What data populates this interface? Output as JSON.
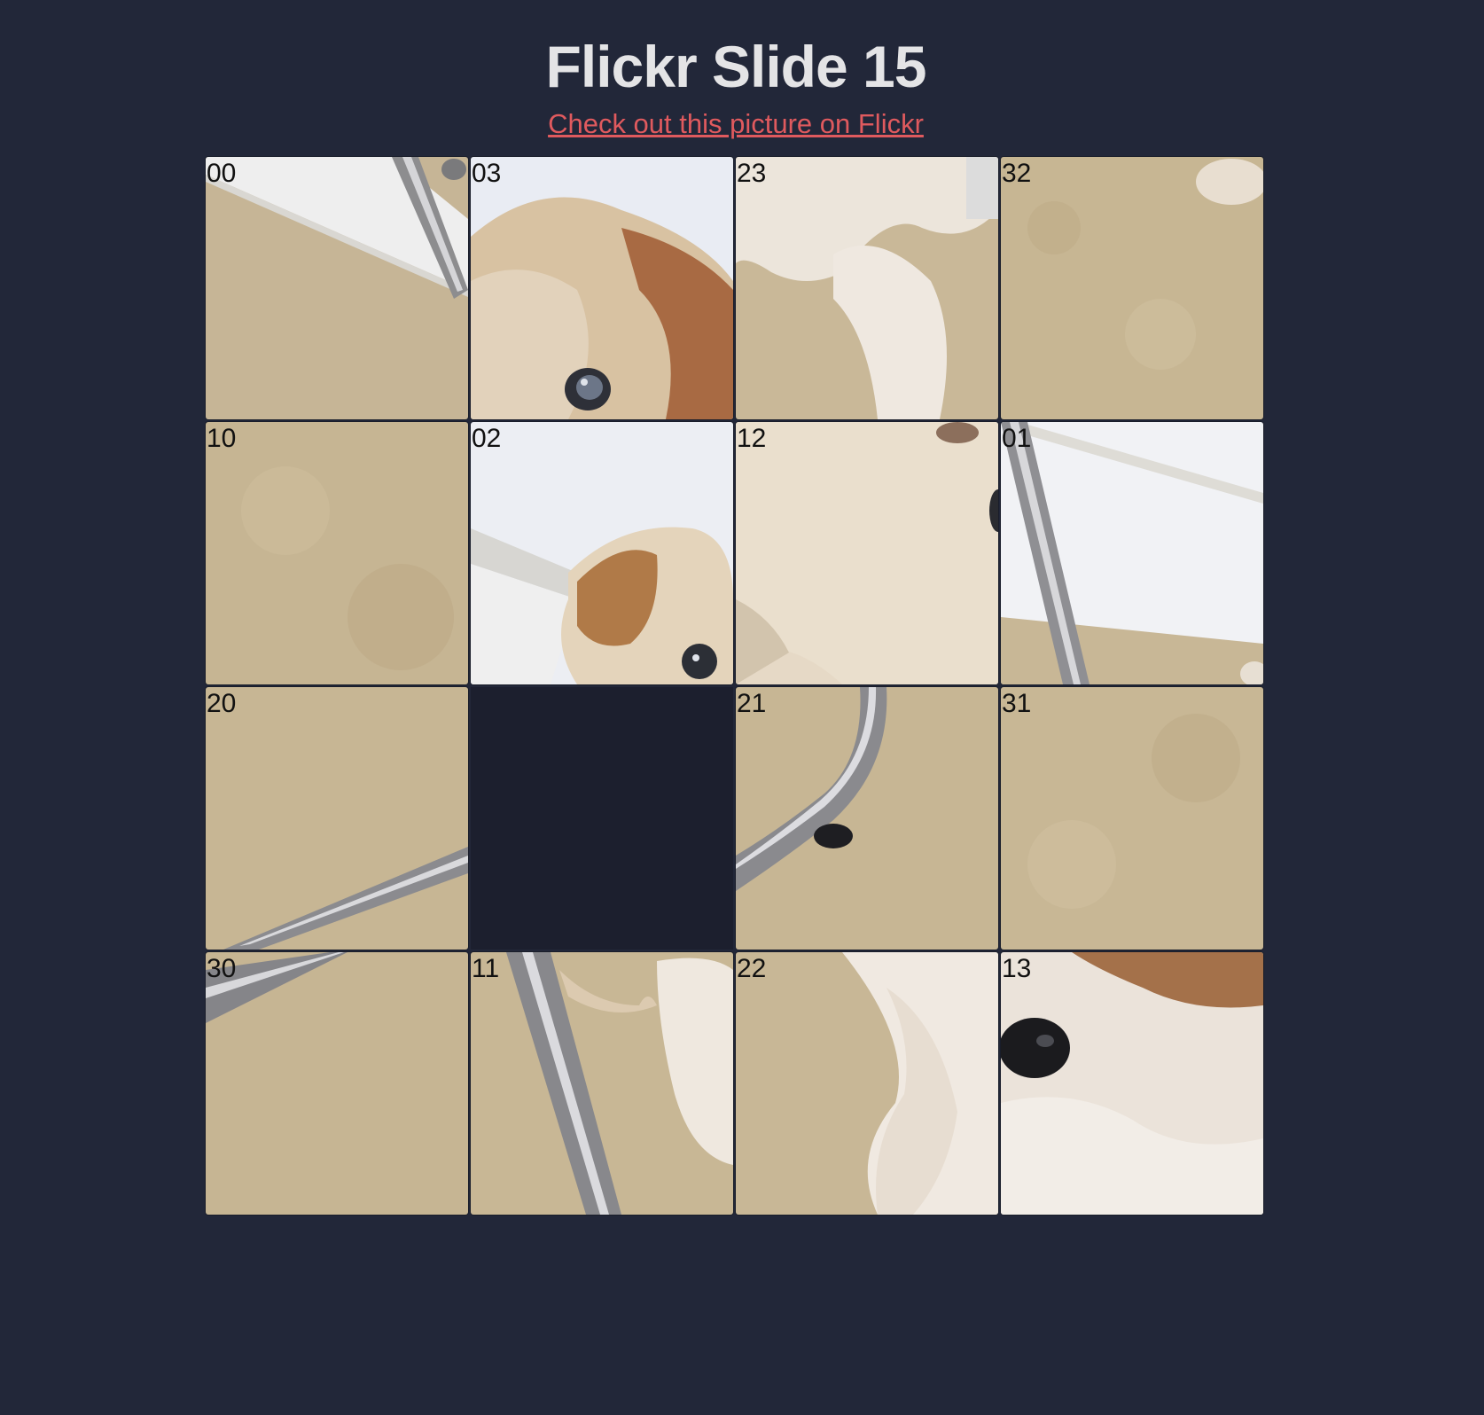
{
  "page": {
    "title": "Flickr Slide 15",
    "link_text": "Check out this picture on Flickr"
  },
  "colors": {
    "background": "#222739",
    "title": "#e4e4e6",
    "link": "#e05a5e",
    "empty_slot": "#1c1f2e"
  },
  "puzzle": {
    "grid_size": 4,
    "empty_position": {
      "row": 2,
      "col": 1
    },
    "tiles": [
      {
        "row": 0,
        "col": 0,
        "label": "00"
      },
      {
        "row": 0,
        "col": 1,
        "label": "03"
      },
      {
        "row": 0,
        "col": 2,
        "label": "23"
      },
      {
        "row": 0,
        "col": 3,
        "label": "32"
      },
      {
        "row": 1,
        "col": 0,
        "label": "10"
      },
      {
        "row": 1,
        "col": 1,
        "label": "02"
      },
      {
        "row": 1,
        "col": 2,
        "label": "12"
      },
      {
        "row": 1,
        "col": 3,
        "label": "01"
      },
      {
        "row": 2,
        "col": 0,
        "label": "20"
      },
      {
        "row": 2,
        "col": 2,
        "label": "21"
      },
      {
        "row": 2,
        "col": 3,
        "label": "31"
      },
      {
        "row": 3,
        "col": 0,
        "label": "30"
      },
      {
        "row": 3,
        "col": 1,
        "label": "11"
      },
      {
        "row": 3,
        "col": 2,
        "label": "22"
      },
      {
        "row": 3,
        "col": 3,
        "label": "13"
      }
    ]
  }
}
